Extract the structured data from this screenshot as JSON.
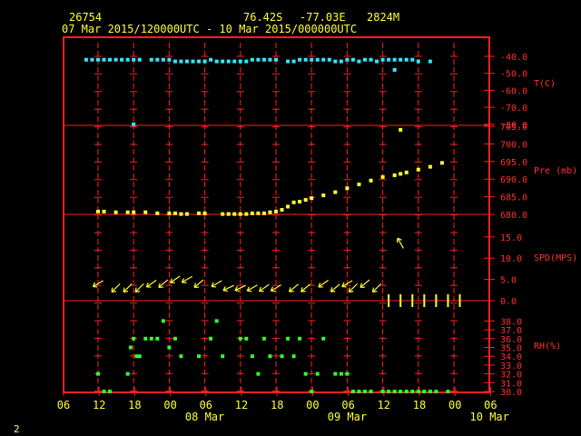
{
  "header": {
    "station_id": "26754",
    "lat": "76.42S",
    "lon": "-77.03E",
    "elev": "2824M",
    "time_range": "07 Mar 2015/120000UTC - 10 Mar 2015/000000UTC",
    "corner_label": "2"
  },
  "colors": {
    "frame": "#ff2020",
    "text": "#ffff33",
    "label": "#ff3030",
    "temp": "#33e6ff",
    "pres": "#ffff33",
    "wind": "#ffff33",
    "rh": "#33ff33"
  },
  "chart_data": [
    {
      "type": "scatter",
      "panel": "temperature",
      "ylabel": "T(C)",
      "yticks": [
        "-40.0",
        "-50.0",
        "-60.0",
        "-70.0",
        "-80.0"
      ],
      "x_hours": [
        -2,
        -1,
        0,
        1,
        2,
        3,
        4,
        5,
        6,
        7,
        9,
        10,
        11,
        12,
        13,
        14,
        15,
        16,
        17,
        18,
        19,
        20,
        21,
        22,
        23,
        24,
        25,
        26,
        27,
        28,
        29,
        30,
        32,
        33,
        34,
        35,
        36,
        37,
        38,
        39,
        40,
        41,
        42,
        43,
        44,
        45,
        46,
        47,
        48,
        49,
        50,
        51,
        52,
        53,
        54,
        56,
        6,
        50
      ],
      "values": [
        -42,
        -42,
        -42,
        -42,
        -42,
        -42,
        -42,
        -42,
        -42,
        -42,
        -42,
        -42,
        -42,
        -42,
        -43,
        -43,
        -43,
        -43,
        -43,
        -43,
        -42,
        -43,
        -43,
        -43,
        -43,
        -43,
        -43,
        -42,
        -42,
        -42,
        -42,
        -42,
        -43,
        -43,
        -42,
        -42,
        -42,
        -42,
        -42,
        -42,
        -43,
        -43,
        -42,
        -42,
        -43,
        -42,
        -42,
        -43,
        -42,
        -42,
        -42,
        -42,
        -42,
        -42,
        -43,
        -43,
        -80,
        -48
      ]
    },
    {
      "type": "scatter",
      "panel": "pressure",
      "ylabel": "Pre (mb)",
      "yticks": [
        "705.0",
        "700.0",
        "695.0",
        "690.0",
        "685.0",
        "680.0"
      ],
      "x_hours": [
        0,
        1,
        3,
        5,
        6,
        8,
        10,
        12,
        13,
        14,
        15,
        17,
        18,
        21,
        22,
        23,
        24,
        25,
        26,
        27,
        28,
        29,
        30,
        31,
        32,
        33,
        34,
        35,
        36,
        38,
        40,
        42,
        44,
        46,
        48,
        50,
        51,
        52,
        54,
        56,
        58,
        51
      ],
      "values": [
        680.8,
        680.8,
        680.6,
        680.6,
        680.6,
        680.6,
        680.3,
        680.3,
        680.3,
        680.1,
        680.1,
        680.3,
        680.3,
        680.1,
        680.1,
        680.1,
        680.1,
        680.1,
        680.3,
        680.3,
        680.3,
        680.6,
        680.8,
        681.3,
        682.2,
        683.4,
        683.6,
        684.1,
        684.6,
        685.4,
        686.3,
        687.4,
        688.5,
        689.6,
        690.6,
        691.1,
        691.5,
        691.9,
        692.7,
        693.5,
        694.6,
        704.0
      ]
    },
    {
      "type": "scatter",
      "panel": "wind",
      "ylabel": "SPD(MPS)",
      "yticks": [
        "15.0",
        "10.0",
        "5.0",
        "0.0"
      ],
      "x_hours": [
        0,
        3,
        5,
        7,
        9,
        11,
        13,
        15,
        17,
        20,
        22,
        24,
        26,
        28,
        30,
        33,
        35,
        38,
        40,
        42,
        43,
        45,
        47,
        49,
        51,
        53,
        55,
        57,
        59,
        61,
        51
      ],
      "values": [
        4,
        3,
        3,
        3,
        4,
        4,
        5,
        5,
        4,
        4,
        3,
        3,
        3,
        3,
        3,
        3,
        3,
        4,
        3,
        4,
        3,
        4,
        3,
        0,
        0,
        0,
        0,
        0,
        0,
        0,
        13.5
      ],
      "direction_deg": [
        30,
        45,
        45,
        45,
        35,
        40,
        35,
        30,
        40,
        30,
        25,
        25,
        30,
        35,
        30,
        40,
        40,
        35,
        40,
        30,
        45,
        40,
        45,
        0,
        0,
        0,
        0,
        0,
        0,
        0,
        300
      ]
    },
    {
      "type": "scatter",
      "panel": "humidity",
      "ylabel": "RH(%)",
      "yticks": [
        "38.0",
        "37.0",
        "36.0",
        "35.0",
        "34.0",
        "33.0",
        "32.0",
        "31.0",
        "30.0"
      ],
      "x_hours": [
        0,
        1,
        2,
        5,
        5.5,
        6,
        6.5,
        7,
        8,
        9,
        10,
        11,
        12,
        13,
        14,
        17,
        19,
        20,
        21,
        24,
        25,
        26,
        27,
        28,
        29,
        31,
        32,
        33,
        34,
        35,
        36,
        37,
        38,
        40,
        41,
        42,
        43,
        44,
        45,
        46,
        48,
        49,
        50,
        51,
        52,
        53,
        54,
        55,
        56,
        57,
        59
      ],
      "values": [
        32,
        30,
        30,
        32,
        35,
        36,
        34,
        34,
        36,
        36,
        36,
        38,
        35,
        36,
        34,
        34,
        36,
        38,
        34,
        36,
        36,
        34,
        32,
        36,
        34,
        34,
        36,
        34,
        36,
        32,
        30,
        32,
        36,
        32,
        32,
        32,
        30,
        30,
        30,
        30,
        30,
        30,
        30,
        30,
        30,
        30,
        30,
        30,
        30,
        30,
        30
      ]
    },
    {
      "type": "axis",
      "xticks": [
        "06",
        "12",
        "18",
        "00",
        "06",
        "12",
        "18",
        "00",
        "06",
        "12",
        "18",
        "00",
        "06"
      ],
      "day_labels": [
        "08 Mar",
        "09 Mar",
        "10 Mar"
      ]
    }
  ]
}
